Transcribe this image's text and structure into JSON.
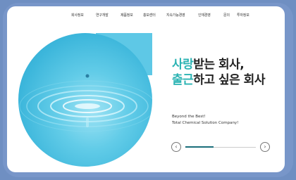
{
  "nav": {
    "items": [
      {
        "label": "회사정보"
      },
      {
        "label": "연구개발"
      },
      {
        "label": "제품정보"
      },
      {
        "label": "홍보센터"
      },
      {
        "label": "지속가능경영"
      },
      {
        "label": "인재경영"
      },
      {
        "label": "문의"
      },
      {
        "label": "투자정보"
      }
    ]
  },
  "hero": {
    "line1_accent": "사랑",
    "line1_rest": "받는 회사,",
    "line2_accent": "출근",
    "line2_rest": "하고 싶은 회사",
    "sub1": "Beyond the Best!",
    "sub2": "Total Chemical Solution Company!",
    "prev_icon": "chevron-left-icon",
    "next_icon": "chevron-right-icon",
    "progress": 0.4
  },
  "colors": {
    "accent": "#2bb3b3",
    "water": "#3cb6db",
    "frame": "#7896c9"
  }
}
